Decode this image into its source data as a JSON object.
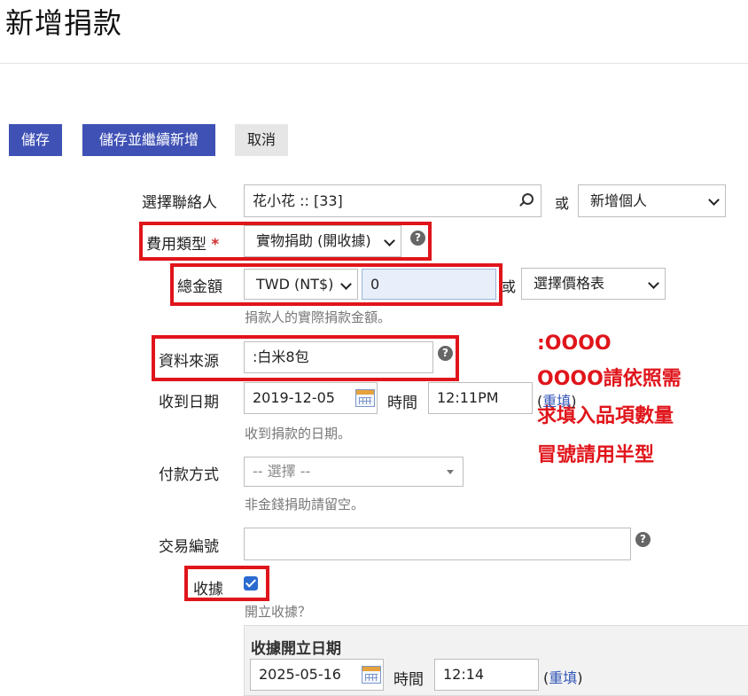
{
  "page": {
    "title": "新增捐款"
  },
  "toolbar": {
    "save_label": "儲存",
    "save_new_label": "儲存並繼續新增",
    "cancel_label": "取消"
  },
  "form": {
    "contact": {
      "label": "選擇聯絡人",
      "value": "花小花 :: [33]",
      "or": "或",
      "new_select": "新增個人"
    },
    "fee_type": {
      "label": "費用類型",
      "required_mark": "*",
      "value": "實物捐助 (開收據)"
    },
    "total_amount": {
      "label": "總金額",
      "currency": "TWD (NT$)",
      "value": "0",
      "or": "或",
      "price_set": "選擇價格表",
      "hint": "捐款人的實際捐款金額。"
    },
    "source": {
      "label": "資料來源",
      "value": ":白米8包"
    },
    "received_date": {
      "label": "收到日期",
      "date": "2019-12-05",
      "time_label": "時間",
      "time": "12:11PM",
      "reset_open": "(",
      "reset_link": "重填",
      "reset_close": ")",
      "hint": "收到捐款的日期。"
    },
    "payment_method": {
      "label": "付款方式",
      "placeholder": "-- 選擇 --",
      "hint": "非金錢捐助請留空。"
    },
    "transaction_id": {
      "label": "交易編號",
      "value": ""
    },
    "receipt": {
      "label": "收據",
      "checked": true,
      "hint": "開立收據？"
    },
    "receipt_date": {
      "label": "收據開立日期",
      "date": "2025-05-16",
      "time_label": "時間",
      "time": "12:14",
      "reset_open": "(",
      "reset_link": "重填",
      "reset_close": ")"
    }
  },
  "annotation": {
    "line1": ":OOOO",
    "line2": "OOOO請依照需",
    "line3": "求填入品項數量",
    "line4": "冒號請用半型",
    "color": "#e0151b"
  },
  "colors": {
    "primary": "#3f51b5",
    "highlight_border": "#e0151b",
    "link": "#3558b8"
  }
}
